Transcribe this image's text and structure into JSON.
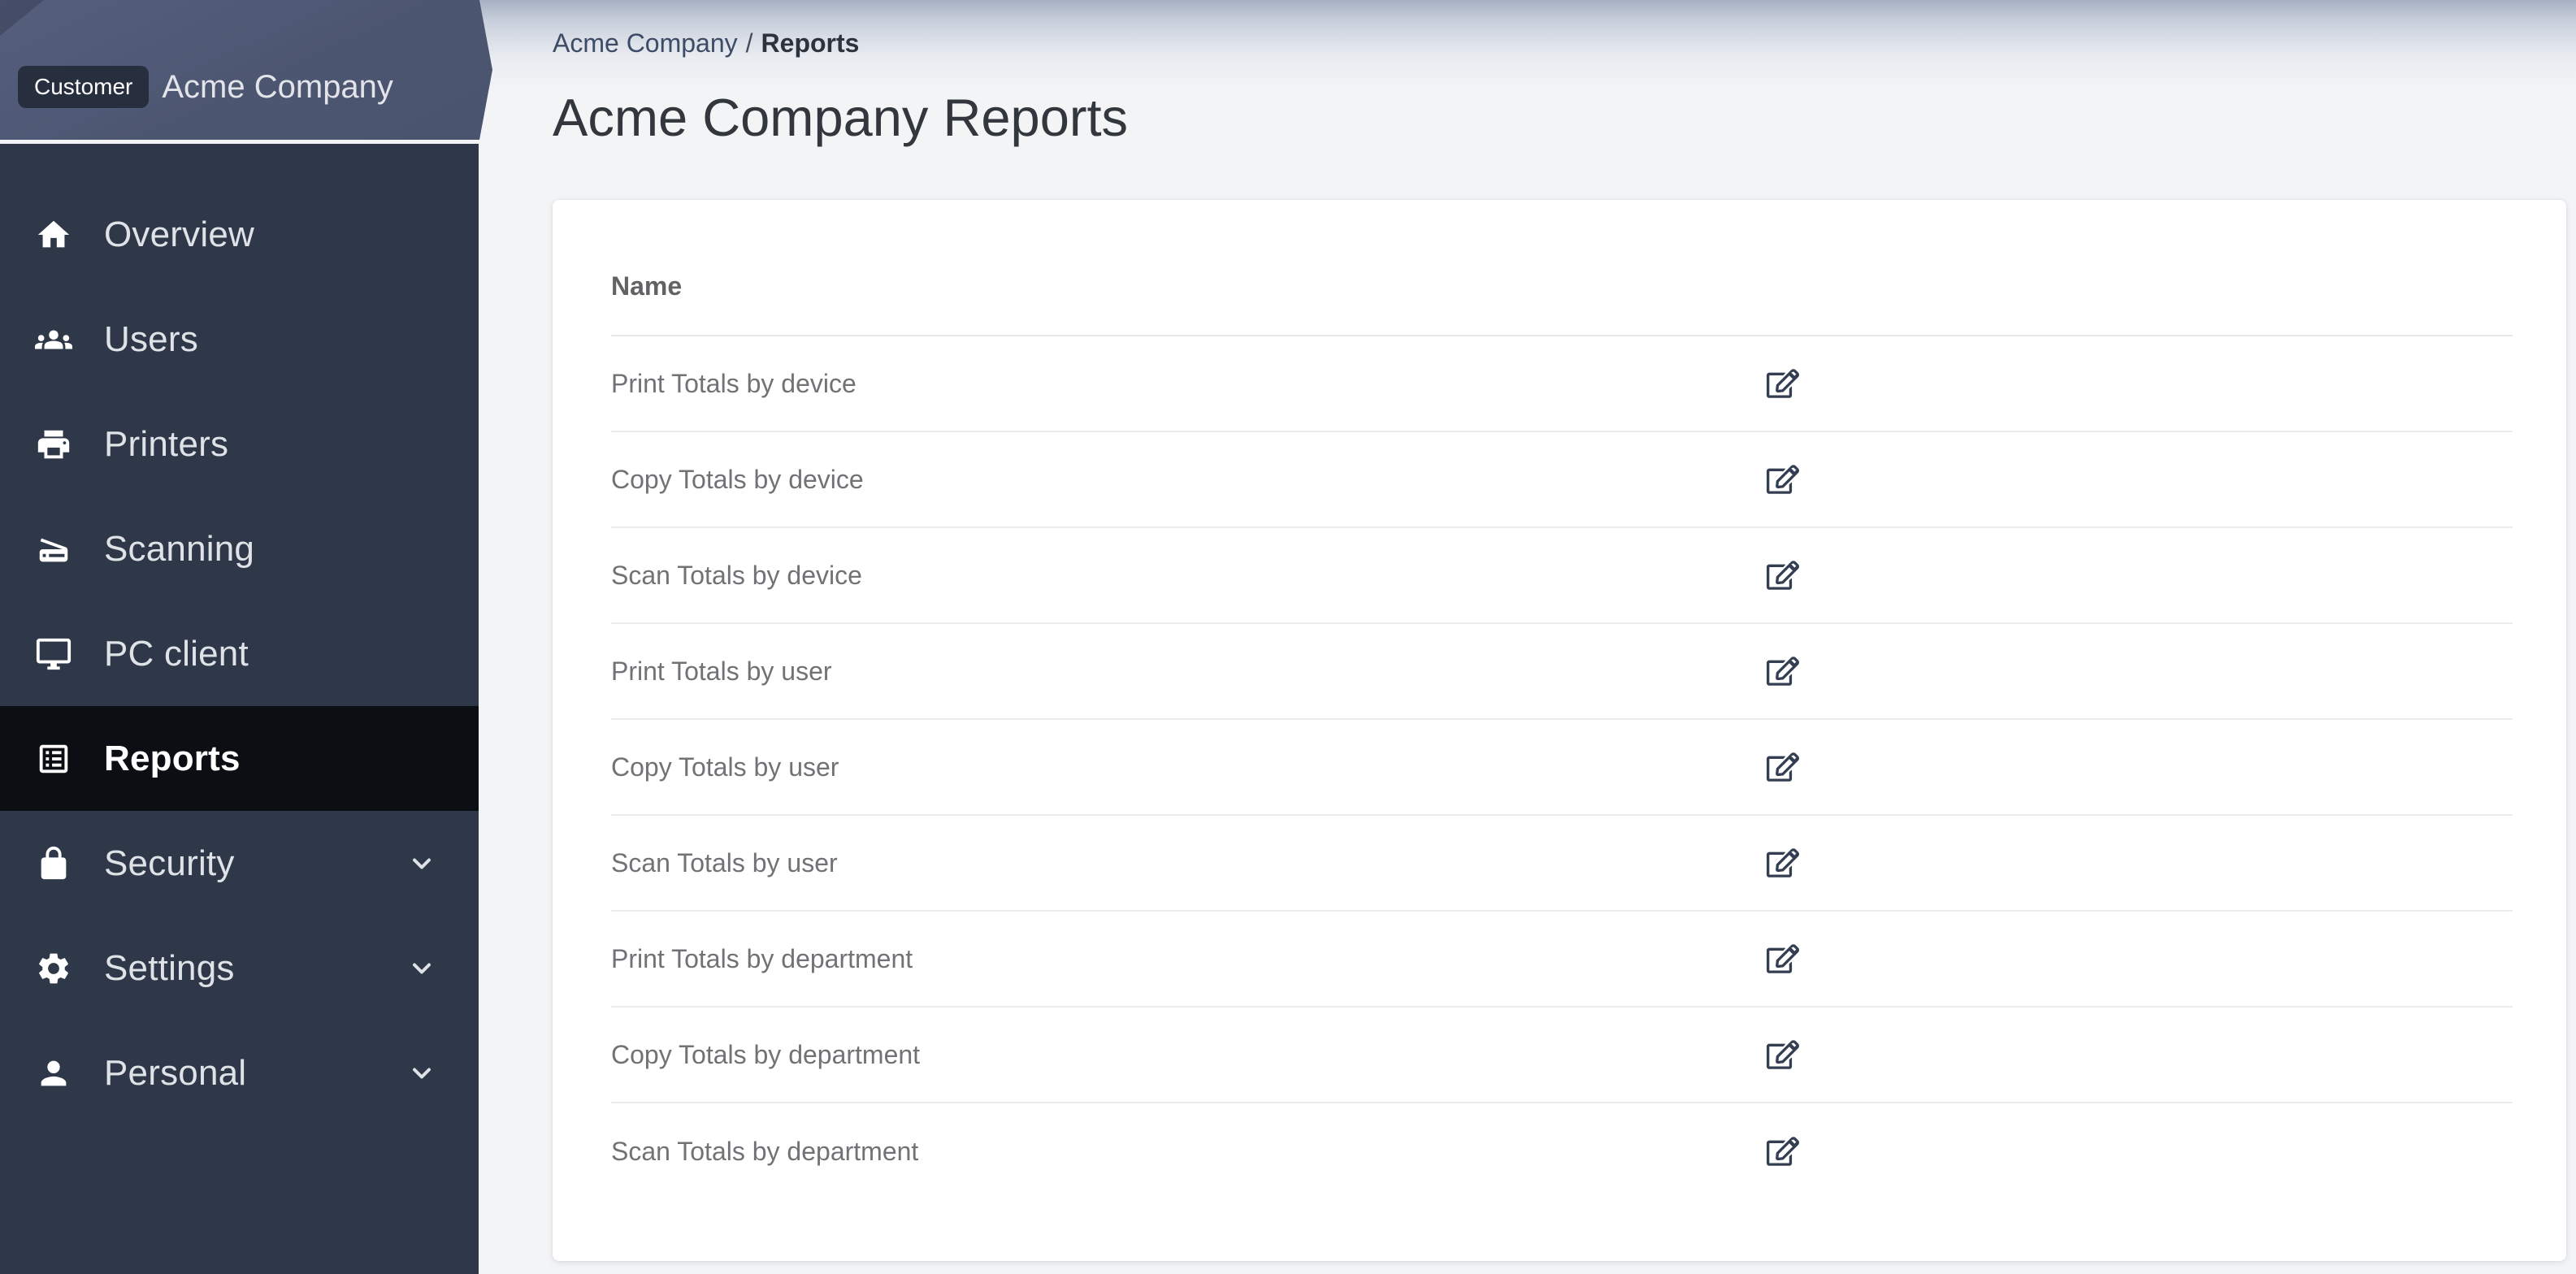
{
  "sidebar": {
    "badge": "Customer",
    "company": "Acme Company",
    "items": [
      {
        "label": "Overview",
        "icon": "home-icon",
        "active": false,
        "expandable": false
      },
      {
        "label": "Users",
        "icon": "users-icon",
        "active": false,
        "expandable": false
      },
      {
        "label": "Printers",
        "icon": "printer-icon",
        "active": false,
        "expandable": false
      },
      {
        "label": "Scanning",
        "icon": "scanner-icon",
        "active": false,
        "expandable": false
      },
      {
        "label": "PC client",
        "icon": "desktop-icon",
        "active": false,
        "expandable": false
      },
      {
        "label": "Reports",
        "icon": "reports-icon",
        "active": true,
        "expandable": false
      },
      {
        "label": "Security",
        "icon": "lock-icon",
        "active": false,
        "expandable": true
      },
      {
        "label": "Settings",
        "icon": "gear-icon",
        "active": false,
        "expandable": true
      },
      {
        "label": "Personal",
        "icon": "person-icon",
        "active": false,
        "expandable": true
      }
    ]
  },
  "breadcrumb": {
    "parent": "Acme Company",
    "separator": "/",
    "current": "Reports"
  },
  "page": {
    "title": "Acme Company Reports"
  },
  "table": {
    "columns": [
      {
        "label": "Name"
      }
    ],
    "rows": [
      {
        "name": "Print Totals by device"
      },
      {
        "name": "Copy Totals by device"
      },
      {
        "name": "Scan Totals by device"
      },
      {
        "name": "Print Totals by user"
      },
      {
        "name": "Copy Totals by user"
      },
      {
        "name": "Scan Totals by user"
      },
      {
        "name": "Print Totals by department"
      },
      {
        "name": "Copy Totals by department"
      },
      {
        "name": "Scan Totals by department"
      }
    ],
    "row_action": "edit"
  },
  "colors": {
    "sidebar_bg": "#2e3848",
    "sidebar_active_bg": "#0b0e13",
    "banner_bg": "#4d5671",
    "badge_bg": "#272f3e",
    "icon_accent": "#343e52",
    "breadcrumb_link": "#3d4c66",
    "row_text": "#707275"
  }
}
